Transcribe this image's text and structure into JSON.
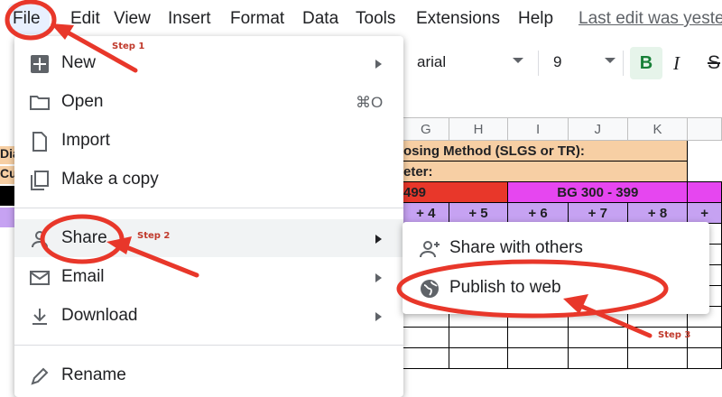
{
  "menubar": {
    "items": [
      "File",
      "Edit",
      "View",
      "Insert",
      "Format",
      "Data",
      "Tools",
      "Extensions",
      "Help"
    ],
    "last_edit": "Last edit was yeste"
  },
  "toolbar": {
    "font": "arial",
    "size": "9",
    "bold": "B",
    "italic": "I",
    "strike": "S"
  },
  "sheet": {
    "columns": [
      "G",
      "H",
      "I",
      "J",
      "K",
      ""
    ],
    "row1": "osing Method (SLGS or TR):",
    "row2": "eter:",
    "red_label": " 499",
    "mag_label": "BG 300 - 399",
    "plus_cells": [
      "+ 4",
      "+ 5",
      "+ 6",
      "+ 7",
      "+ 8",
      "+"
    ]
  },
  "left_strip": [
    "Dia",
    "Cu"
  ],
  "file_menu": {
    "items": [
      {
        "label": "New",
        "icon": "new-sheet-icon"
      },
      {
        "label": "Open",
        "icon": "folder-icon",
        "shortcut": "⌘O"
      },
      {
        "label": "Import",
        "icon": "file-icon"
      },
      {
        "label": "Make a copy",
        "icon": "copy-icon"
      },
      {
        "label": "Share",
        "icon": "person-icon"
      },
      {
        "label": "Email",
        "icon": "mail-icon"
      },
      {
        "label": "Download",
        "icon": "download-icon"
      },
      {
        "label": "Rename",
        "icon": "pencil-icon"
      }
    ]
  },
  "share_submenu": {
    "items": [
      {
        "label": "Share with others",
        "icon": "person-add-icon"
      },
      {
        "label": "Publish to web",
        "icon": "globe-icon"
      }
    ]
  },
  "annotations": {
    "step1": "Step 1",
    "step2": "Step 2",
    "step3": "Step 3",
    "color": "#e8372a"
  }
}
